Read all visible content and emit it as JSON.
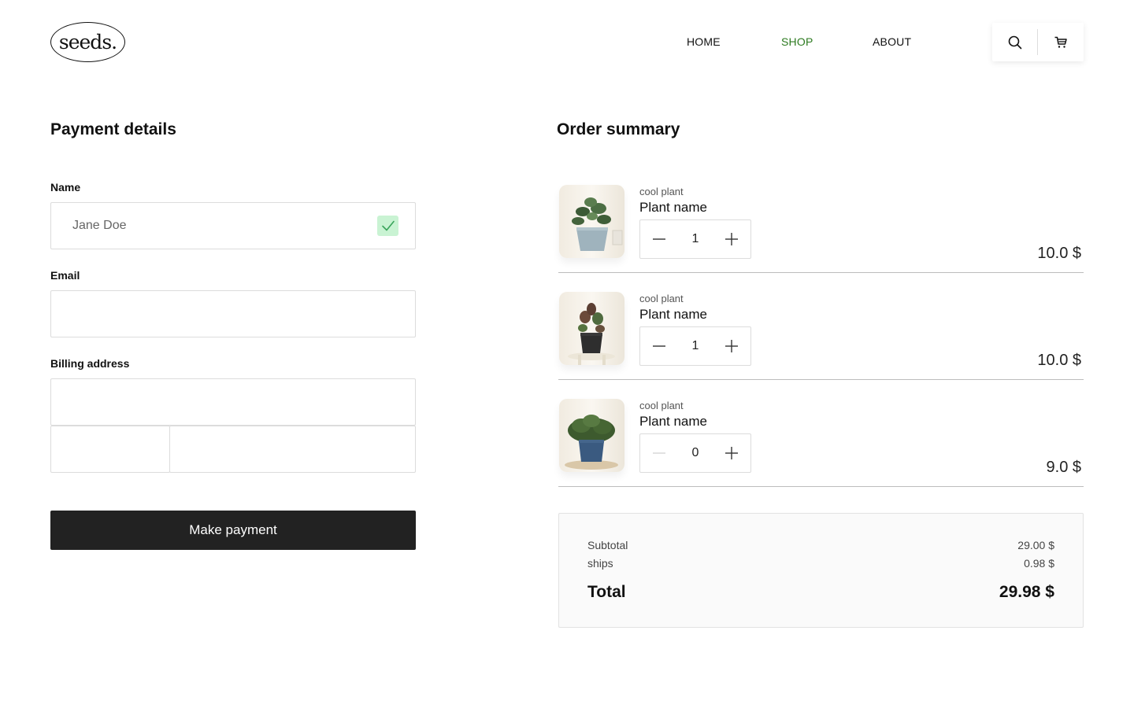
{
  "brand": {
    "logo_text": "seeds."
  },
  "nav": {
    "items": [
      {
        "label": "HOME",
        "active": false
      },
      {
        "label": "SHOP",
        "active": true
      },
      {
        "label": "ABOUT",
        "active": false
      }
    ],
    "icons": [
      "search-icon",
      "cart-icon"
    ]
  },
  "colors": {
    "accent": "#2c7a1f",
    "button": "#222222",
    "check_bg": "#c9f3d3",
    "check_mark": "#3aa55b"
  },
  "payment": {
    "title": "Payment details",
    "name_label": "Name",
    "name_value": "Jane Doe",
    "email_label": "Email",
    "email_value": "",
    "billing_label": "Billing address",
    "billing_street": "",
    "billing_zip": "",
    "billing_city": "",
    "submit_label": "Make payment"
  },
  "order": {
    "title": "Order summary",
    "items": [
      {
        "subtitle": "cool plant",
        "name": "Plant name",
        "qty": "1",
        "price": "10.0 $"
      },
      {
        "subtitle": "cool plant",
        "name": "Plant name",
        "qty": "1",
        "price": "10.0 $"
      },
      {
        "subtitle": "cool plant",
        "name": "Plant name",
        "qty": "0",
        "price": "9.0 $"
      }
    ]
  },
  "summary": {
    "subtotal_label": "Subtotal",
    "subtotal_value": "29.00 $",
    "ships_label": "ships",
    "ships_value": "0.98 $",
    "total_label": "Total",
    "total_value": "29.98 $"
  }
}
